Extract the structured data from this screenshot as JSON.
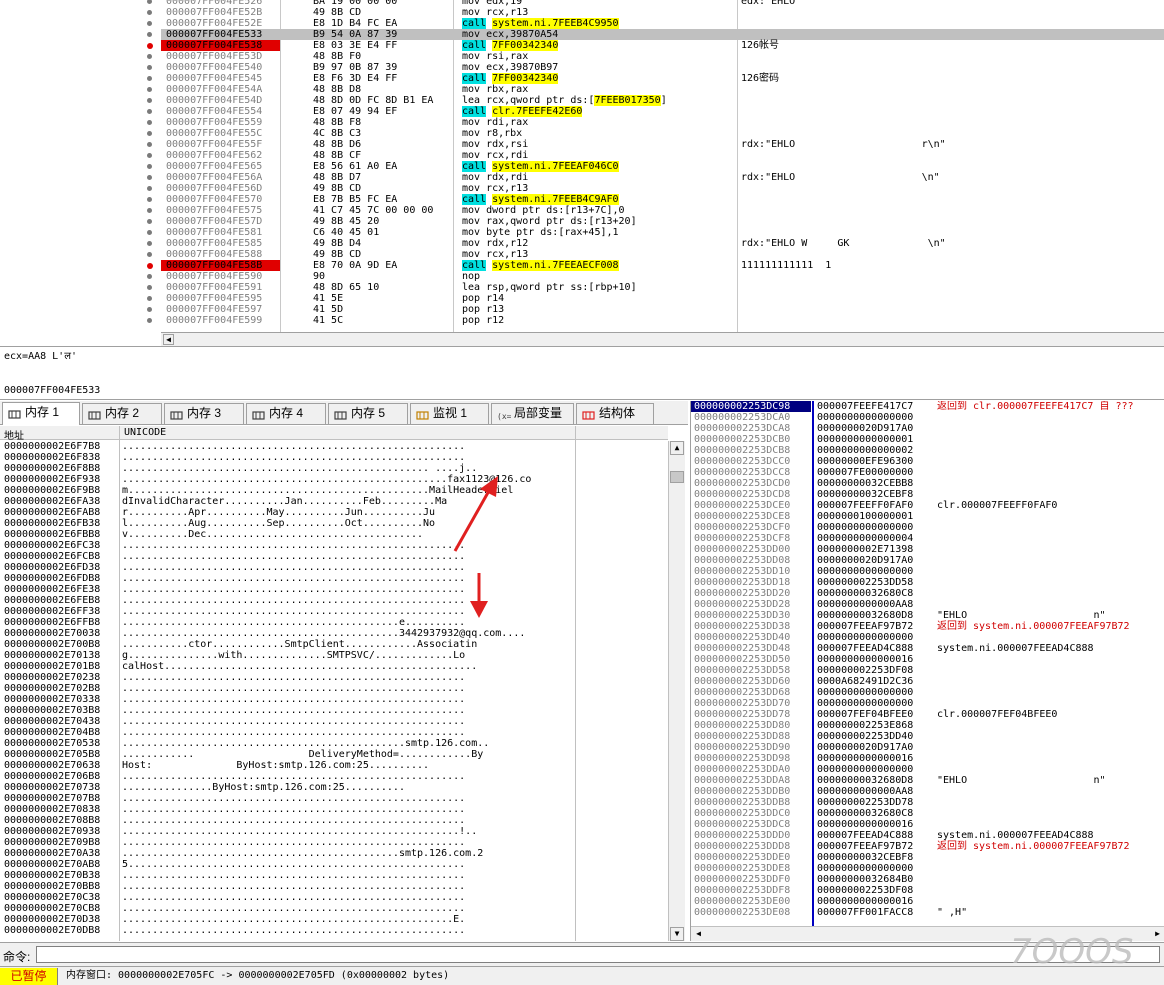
{
  "disasm": {
    "rows": [
      {
        "addr": "000007FF004FE526",
        "bytes": "BA 19 00 00 00",
        "mnem": "mov edx,19",
        "comment": "edx:\"EHLO",
        "mark": "dot"
      },
      {
        "addr": "000007FF004FE52B",
        "bytes": "49 8B CD",
        "mnem": "mov rcx,r13",
        "comment": "",
        "mark": "dot"
      },
      {
        "addr": "000007FF004FE52E",
        "bytes": "E8 1D B4 FC EA",
        "mnem": "call system.ni.7FEEB4C9950",
        "comment": "",
        "mark": "dot",
        "call": true
      },
      {
        "addr": "000007FF004FE533",
        "bytes": "B9 54 0A 87 39",
        "mnem": "mov ecx,39870A54",
        "comment": "",
        "mark": "dot",
        "selected": true
      },
      {
        "addr": "000007FF004FE538",
        "bytes": "E8 03 3E E4 FF",
        "mnem": "call 7FF00342340",
        "comment": "126帐号",
        "mark": "bp",
        "call": true
      },
      {
        "addr": "000007FF004FE53D",
        "bytes": "48 8B F0",
        "mnem": "mov rsi,rax",
        "comment": "",
        "mark": "dot"
      },
      {
        "addr": "000007FF004FE540",
        "bytes": "B9 97 0B 87 39",
        "mnem": "mov ecx,39870B97",
        "comment": "",
        "mark": "dot"
      },
      {
        "addr": "000007FF004FE545",
        "bytes": "E8 F6 3D E4 FF",
        "mnem": "call 7FF00342340",
        "comment": "126密码",
        "mark": "dot",
        "call": true
      },
      {
        "addr": "000007FF004FE54A",
        "bytes": "48 8B D8",
        "mnem": "mov rbx,rax",
        "comment": "",
        "mark": "dot"
      },
      {
        "addr": "000007FF004FE54D",
        "bytes": "48 8D 0D FC 8D B1 EA",
        "mnem": "lea rcx,qword ptr ds:[7FEEB017350]",
        "comment": "",
        "mark": "dot",
        "lea": true
      },
      {
        "addr": "000007FF004FE554",
        "bytes": "E8 07 49 94 EF",
        "mnem": "call clr.7FEEFE42E60",
        "comment": "",
        "mark": "dot",
        "call": true
      },
      {
        "addr": "000007FF004FE559",
        "bytes": "48 8B F8",
        "mnem": "mov rdi,rax",
        "comment": "",
        "mark": "dot"
      },
      {
        "addr": "000007FF004FE55C",
        "bytes": "4C 8B C3",
        "mnem": "mov r8,rbx",
        "comment": "",
        "mark": "dot"
      },
      {
        "addr": "000007FF004FE55F",
        "bytes": "48 8B D6",
        "mnem": "mov rdx,rsi",
        "comment": "rdx:\"EHLO                     r\\n\"",
        "mark": "dot"
      },
      {
        "addr": "000007FF004FE562",
        "bytes": "48 8B CF",
        "mnem": "mov rcx,rdi",
        "comment": "",
        "mark": "dot"
      },
      {
        "addr": "000007FF004FE565",
        "bytes": "E8 56 61 A0 EA",
        "mnem": "call system.ni.7FEEAF046C0",
        "comment": "",
        "mark": "dot",
        "call": true
      },
      {
        "addr": "000007FF004FE56A",
        "bytes": "48 8B D7",
        "mnem": "mov rdx,rdi",
        "comment": "rdx:\"EHLO                     \\n\"",
        "mark": "dot"
      },
      {
        "addr": "000007FF004FE56D",
        "bytes": "49 8B CD",
        "mnem": "mov rcx,r13",
        "comment": "",
        "mark": "dot"
      },
      {
        "addr": "000007FF004FE570",
        "bytes": "E8 7B B5 FC EA",
        "mnem": "call system.ni.7FEEB4C9AF0",
        "comment": "",
        "mark": "dot",
        "call": true
      },
      {
        "addr": "000007FF004FE575",
        "bytes": "41 C7 45 7C 00 00 00",
        "mnem": "mov dword ptr ds:[r13+7C],0",
        "comment": "",
        "mark": "dot"
      },
      {
        "addr": "000007FF004FE57D",
        "bytes": "49 8B 45 20",
        "mnem": "mov rax,qword ptr ds:[r13+20]",
        "comment": "",
        "mark": "dot"
      },
      {
        "addr": "000007FF004FE581",
        "bytes": "C6 40 45 01",
        "mnem": "mov byte ptr ds:[rax+45],1",
        "comment": "",
        "mark": "dot"
      },
      {
        "addr": "000007FF004FE585",
        "bytes": "49 8B D4",
        "mnem": "mov rdx,r12",
        "comment": "rdx:\"EHLO W     GK             \\n\"",
        "mark": "dot"
      },
      {
        "addr": "000007FF004FE588",
        "bytes": "49 8B CD",
        "mnem": "mov rcx,r13",
        "comment": "",
        "mark": "dot"
      },
      {
        "addr": "000007FF004FE58B",
        "bytes": "E8 70 0A 9D EA",
        "mnem": "call system.ni.7FEEAECF008",
        "comment": "111111111111  1",
        "mark": "bp",
        "call": true
      },
      {
        "addr": "000007FF004FE590",
        "bytes": "90",
        "mnem": "nop",
        "comment": "",
        "mark": "dot"
      },
      {
        "addr": "000007FF004FE591",
        "bytes": "48 8D 65 10",
        "mnem": "lea rsp,qword ptr ss:[rbp+10]",
        "comment": "",
        "mark": "dot",
        "lea": true
      },
      {
        "addr": "000007FF004FE595",
        "bytes": "41 5E",
        "mnem": "pop r14",
        "comment": "",
        "mark": "dot"
      },
      {
        "addr": "000007FF004FE597",
        "bytes": "41 5D",
        "mnem": "pop r13",
        "comment": "",
        "mark": "dot"
      },
      {
        "addr": "000007FF004FE599",
        "bytes": "41 5C",
        "mnem": "pop r12",
        "comment": "",
        "mark": "dot"
      }
    ]
  },
  "info": {
    "line1": "ecx=AA8 L'ल'",
    "line2": "000007FF004FE533"
  },
  "tabs": [
    {
      "label": "内存 1",
      "icon": "memory-icon"
    },
    {
      "label": "内存 2",
      "icon": "memory-icon"
    },
    {
      "label": "内存 3",
      "icon": "memory-icon"
    },
    {
      "label": "内存 4",
      "icon": "memory-icon"
    },
    {
      "label": "内存 5",
      "icon": "memory-icon"
    },
    {
      "label": "监视 1",
      "icon": "watch-icon"
    },
    {
      "label": "局部变量",
      "icon": "locals-icon"
    },
    {
      "label": "结构体",
      "icon": "struct-icon"
    }
  ],
  "memory": {
    "col_addr": "地址",
    "col_data": "UNICODE",
    "rows": [
      {
        "a": "0000000002E6F7B8",
        "d": "........................................................."
      },
      {
        "a": "0000000002E6F838",
        "d": "........................................................."
      },
      {
        "a": "0000000002E6F8B8",
        "d": "................................................... ....j.."
      },
      {
        "a": "0000000002E6F938",
        "d": "......................................................fax1123@126.co"
      },
      {
        "a": "0000000002E6F9B8",
        "d": "m..................................................MailHeaderFiel"
      },
      {
        "a": "0000000002E6FA38",
        "d": "dInvalidCharacter..........Jan..........Feb.........Ma"
      },
      {
        "a": "0000000002E6FAB8",
        "d": "r..........Apr..........May..........Jun..........Ju"
      },
      {
        "a": "0000000002E6FB38",
        "d": "l..........Aug..........Sep..........Oct..........No"
      },
      {
        "a": "0000000002E6FBB8",
        "d": "v..........Dec...................................."
      },
      {
        "a": "0000000002E6FC38",
        "d": "........................................................."
      },
      {
        "a": "0000000002E6FCB8",
        "d": "........................................................."
      },
      {
        "a": "0000000002E6FD38",
        "d": "........................................................."
      },
      {
        "a": "0000000002E6FDB8",
        "d": "........................................................."
      },
      {
        "a": "0000000002E6FE38",
        "d": "........................................................."
      },
      {
        "a": "0000000002E6FEB8",
        "d": "........................................................."
      },
      {
        "a": "0000000002E6FF38",
        "d": "........................................................."
      },
      {
        "a": "0000000002E6FFB8",
        "d": "..............................................e.........."
      },
      {
        "a": "0000000002E70038",
        "d": "..............................................3442937932@qq.com...."
      },
      {
        "a": "0000000002E700B8",
        "d": "...........ctor............SmtpClient............Associatin"
      },
      {
        "a": "0000000002E70138",
        "d": "g...............with..............SMTPSVC/.............Lo"
      },
      {
        "a": "0000000002E701B8",
        "d": "calHost...................................................."
      },
      {
        "a": "0000000002E70238",
        "d": "........................................................."
      },
      {
        "a": "0000000002E702B8",
        "d": "........................................................."
      },
      {
        "a": "0000000002E70338",
        "d": "........................................................."
      },
      {
        "a": "0000000002E703B8",
        "d": "........................................................."
      },
      {
        "a": "0000000002E70438",
        "d": "........................................................."
      },
      {
        "a": "0000000002E704B8",
        "d": "........................................................."
      },
      {
        "a": "0000000002E70538",
        "d": "...............................................smtp.126.com.."
      },
      {
        "a": "0000000002E705B8",
        "d": "............                   DeliveryMethod=............By"
      },
      {
        "a": "0000000002E70638",
        "d": "Host:              ByHost:smtp.126.com:25.........."
      },
      {
        "a": "0000000002E706B8",
        "d": "........................................................."
      },
      {
        "a": "0000000002E70738",
        "d": "...............ByHost:smtp.126.com:25.........."
      },
      {
        "a": "0000000002E707B8",
        "d": "........................................................."
      },
      {
        "a": "0000000002E70838",
        "d": "........................................................."
      },
      {
        "a": "0000000002E708B8",
        "d": "........................................................."
      },
      {
        "a": "0000000002E70938",
        "d": "........................................................!.."
      },
      {
        "a": "0000000002E709B8",
        "d": "........................................................."
      },
      {
        "a": "0000000002E70A38",
        "d": "..............................................smtp.126.com.2"
      },
      {
        "a": "0000000002E70AB8",
        "d": "5........................................................"
      },
      {
        "a": "0000000002E70B38",
        "d": "........................................................."
      },
      {
        "a": "0000000002E70BB8",
        "d": "........................................................."
      },
      {
        "a": "0000000002E70C38",
        "d": "........................................................."
      },
      {
        "a": "0000000002E70CB8",
        "d": "........................................................."
      },
      {
        "a": "0000000002E70D38",
        "d": ".......................................................E."
      },
      {
        "a": "0000000002E70DB8",
        "d": "........................................................."
      }
    ]
  },
  "stack": {
    "rows": [
      {
        "a": "000000002253DC98",
        "v": "000007FEEFE417C7",
        "c": "返回到 clr.000007FEEFE417C7 自 ???",
        "ret": true,
        "sel": true
      },
      {
        "a": "000000002253DCA0",
        "v": "0000000000000000",
        "c": ""
      },
      {
        "a": "000000002253DCA8",
        "v": "0000000020D917A0",
        "c": ""
      },
      {
        "a": "000000002253DCB0",
        "v": "0000000000000001",
        "c": ""
      },
      {
        "a": "000000002253DCB8",
        "v": "0000000000000002",
        "c": ""
      },
      {
        "a": "000000002253DCC0",
        "v": "00000000EFE96300",
        "c": ""
      },
      {
        "a": "000000002253DCC8",
        "v": "000007FE00000000",
        "c": ""
      },
      {
        "a": "000000002253DCD0",
        "v": "00000000032CEBB8",
        "c": ""
      },
      {
        "a": "000000002253DCD8",
        "v": "00000000032CEBF8",
        "c": ""
      },
      {
        "a": "000000002253DCE0",
        "v": "000007FEEFF0FAF0",
        "c": "clr.000007FEEFF0FAF0"
      },
      {
        "a": "000000002253DCE8",
        "v": "0000000100000001",
        "c": ""
      },
      {
        "a": "000000002253DCF0",
        "v": "0000000000000000",
        "c": ""
      },
      {
        "a": "000000002253DCF8",
        "v": "0000000000000004",
        "c": ""
      },
      {
        "a": "000000002253DD00",
        "v": "0000000002E71398",
        "c": ""
      },
      {
        "a": "000000002253DD08",
        "v": "0000000020D917A0",
        "c": ""
      },
      {
        "a": "000000002253DD10",
        "v": "0000000000000000",
        "c": ""
      },
      {
        "a": "000000002253DD18",
        "v": "000000002253DD58",
        "c": ""
      },
      {
        "a": "000000002253DD20",
        "v": "00000000032680C8",
        "c": ""
      },
      {
        "a": "000000002253DD28",
        "v": "0000000000000AA8",
        "c": ""
      },
      {
        "a": "000000002253DD30",
        "v": "00000000032680D8",
        "c": "\"EHLO                     n\""
      },
      {
        "a": "000000002253DD38",
        "v": "000007FEEAF97B72",
        "c": "返回到 system.ni.000007FEEAF97B72",
        "ret": true
      },
      {
        "a": "000000002253DD40",
        "v": "0000000000000000",
        "c": ""
      },
      {
        "a": "000000002253DD48",
        "v": "000007FEEAD4C888",
        "c": "system.ni.000007FEEAD4C888"
      },
      {
        "a": "000000002253DD50",
        "v": "0000000000000016",
        "c": ""
      },
      {
        "a": "000000002253DD58",
        "v": "000000002253DF08",
        "c": ""
      },
      {
        "a": "000000002253DD60",
        "v": "0000A682491D2C36",
        "c": ""
      },
      {
        "a": "000000002253DD68",
        "v": "0000000000000000",
        "c": ""
      },
      {
        "a": "000000002253DD70",
        "v": "0000000000000000",
        "c": ""
      },
      {
        "a": "000000002253DD78",
        "v": "000007FEF04BFEE0",
        "c": "clr.000007FEF04BFEE0"
      },
      {
        "a": "000000002253DD80",
        "v": "000000002253E868",
        "c": ""
      },
      {
        "a": "000000002253DD88",
        "v": "000000002253DD40",
        "c": ""
      },
      {
        "a": "000000002253DD90",
        "v": "0000000020D917A0",
        "c": ""
      },
      {
        "a": "000000002253DD98",
        "v": "0000000000000016",
        "c": ""
      },
      {
        "a": "000000002253DDA0",
        "v": "0000000000000000",
        "c": ""
      },
      {
        "a": "000000002253DDA8",
        "v": "00000000032680D8",
        "c": "\"EHLO                     n\""
      },
      {
        "a": "000000002253DDB0",
        "v": "0000000000000AA8",
        "c": ""
      },
      {
        "a": "000000002253DDB8",
        "v": "000000002253DD78",
        "c": ""
      },
      {
        "a": "000000002253DDC0",
        "v": "00000000032680C8",
        "c": ""
      },
      {
        "a": "000000002253DDC8",
        "v": "0000000000000016",
        "c": ""
      },
      {
        "a": "000000002253DDD0",
        "v": "000007FEEAD4C888",
        "c": "system.ni.000007FEEAD4C888"
      },
      {
        "a": "000000002253DDD8",
        "v": "000007FEEAF97B72",
        "c": "返回到 system.ni.000007FEEAF97B72",
        "ret": true
      },
      {
        "a": "000000002253DDE0",
        "v": "00000000032CEBF8",
        "c": ""
      },
      {
        "a": "000000002253DDE8",
        "v": "0000000000000000",
        "c": ""
      },
      {
        "a": "000000002253DDF0",
        "v": "00000000032684B0",
        "c": ""
      },
      {
        "a": "000000002253DDF8",
        "v": "000000002253DF08",
        "c": ""
      },
      {
        "a": "000000002253DE00",
        "v": "0000000000000016",
        "c": ""
      },
      {
        "a": "000000002253DE08",
        "v": "000007FF001FACC8",
        "c": "\" ,H\""
      }
    ]
  },
  "command": {
    "label": "命令:",
    "value": ""
  },
  "status": {
    "state": "已暂停",
    "text": "内存窗口: 0000000002E705FC -> 0000000002E705FD (0x00000002 bytes)"
  },
  "watermark": "7OOOS"
}
